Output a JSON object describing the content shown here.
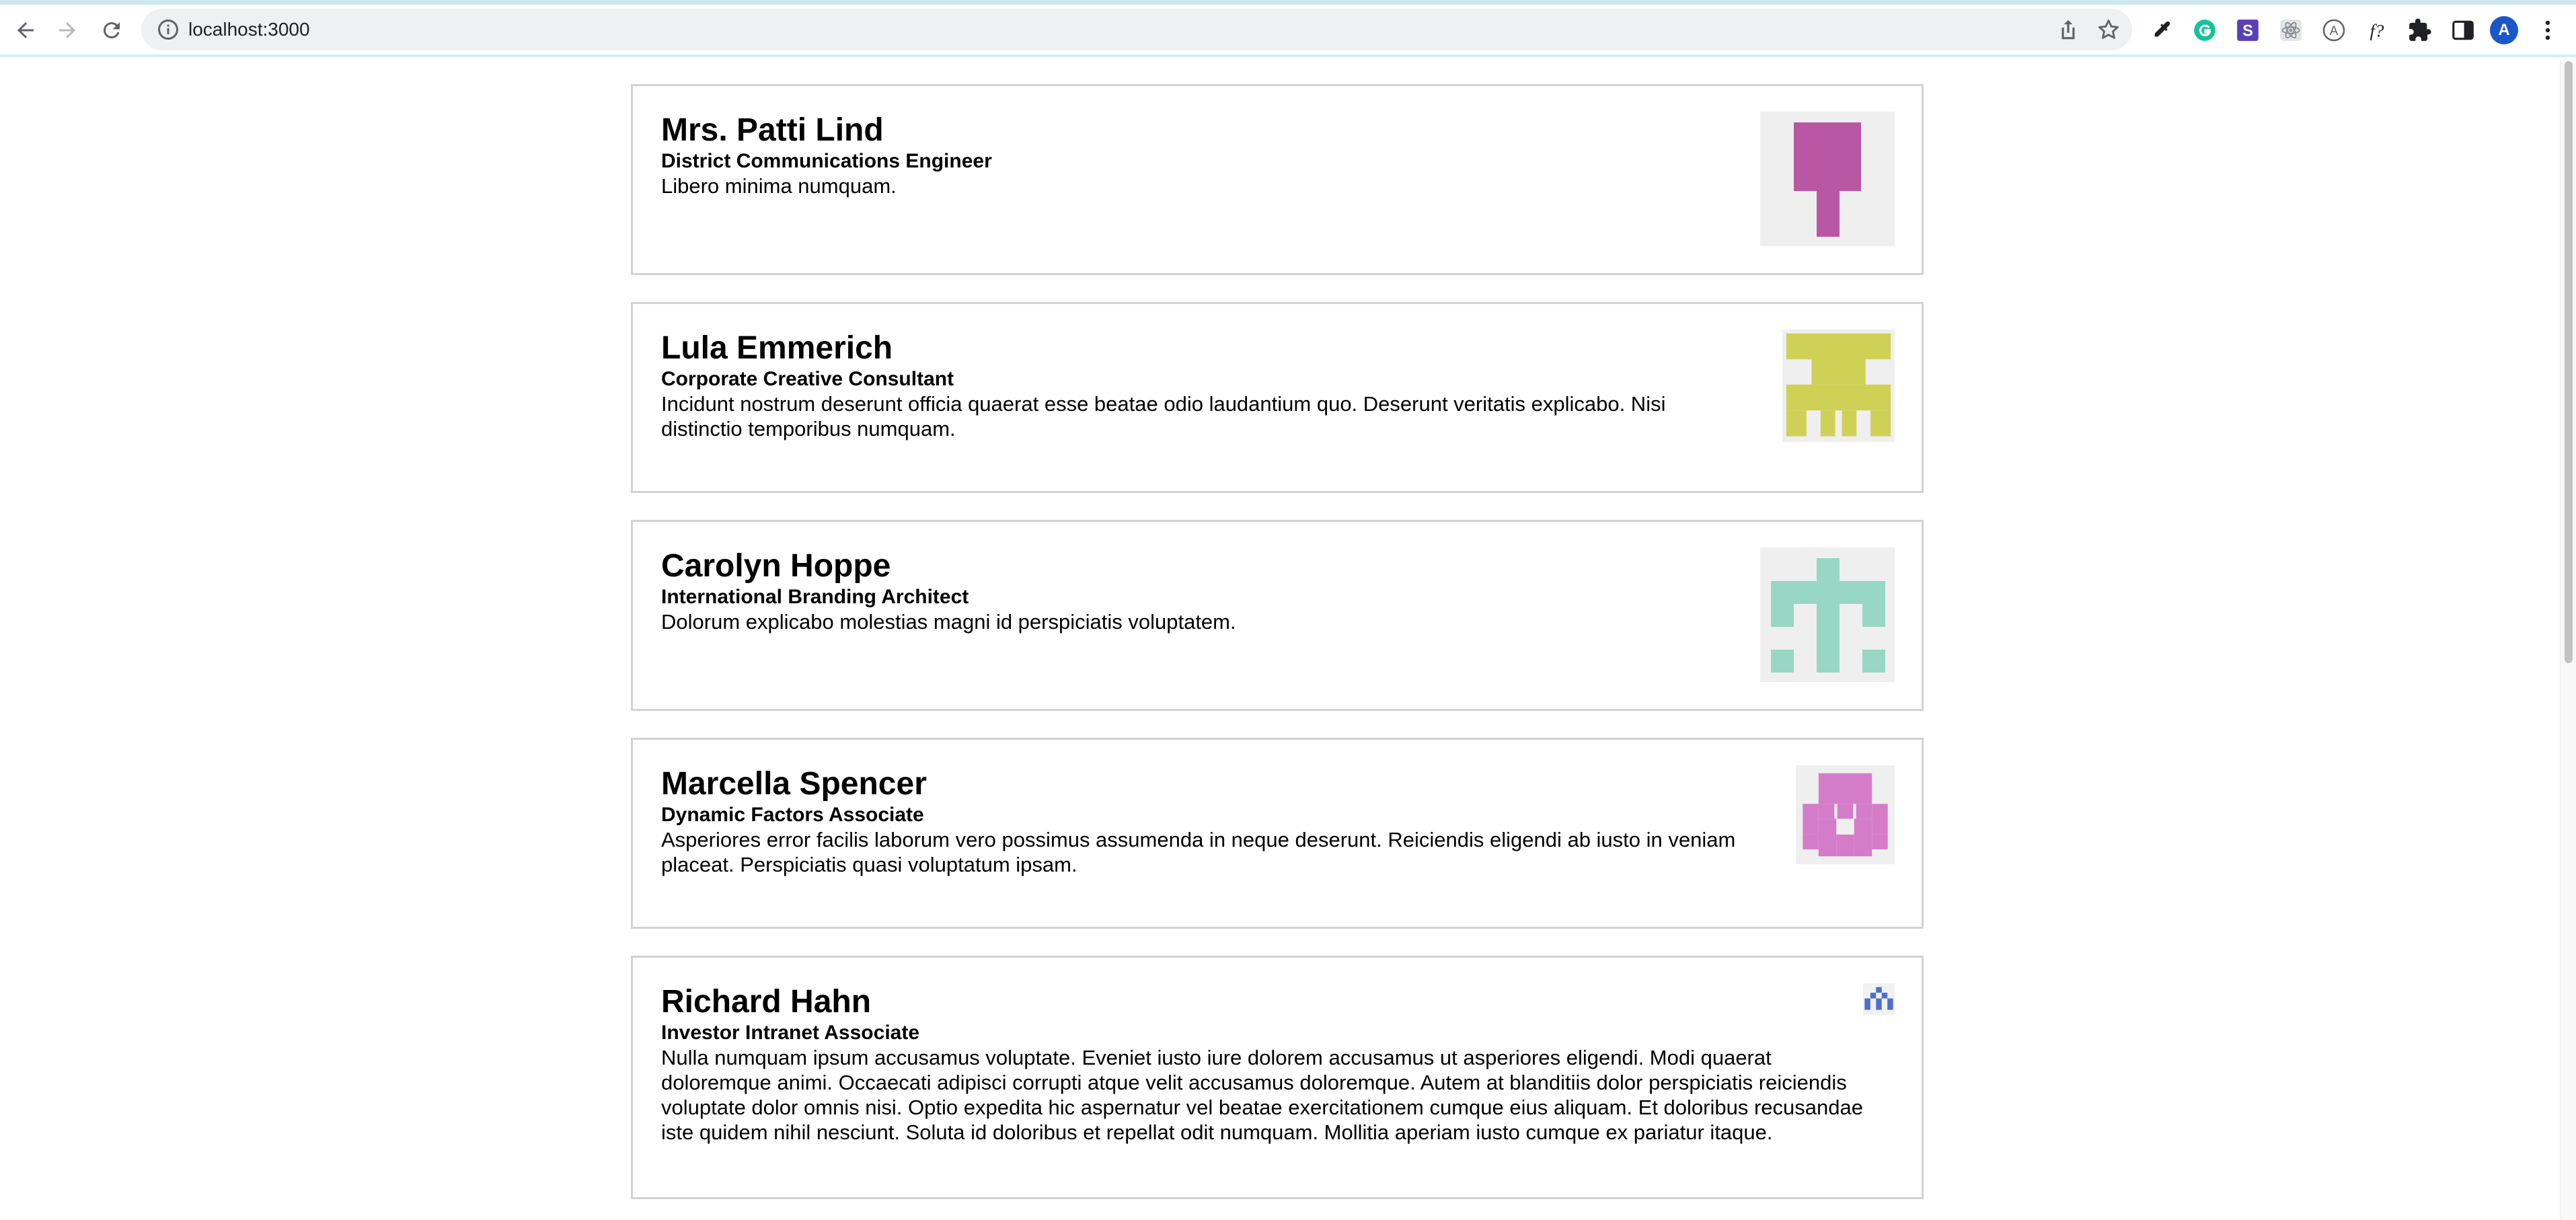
{
  "browser": {
    "url": "localhost:3000",
    "profile_initial": "A",
    "icons": {
      "back": "back-arrow-icon",
      "forward": "forward-arrow-icon",
      "reload": "reload-icon",
      "site_info": "info-icon",
      "share": "share-icon",
      "bookmark": "star-icon",
      "extensions": [
        "eyedropper-icon",
        "grammarly-icon",
        "s-extension-icon",
        "react-devtools-icon",
        "a-extension-icon",
        "formula-icon",
        "puzzle-icon",
        "sidepanel-icon"
      ],
      "menu": "kebab-menu-icon"
    }
  },
  "profiles": [
    {
      "name": "Mrs. Patti Lind",
      "title": "District Communications Engineer",
      "bio": "Libero minima numquam.",
      "avatar_color": "#b957a4"
    },
    {
      "name": "Lula Emmerich",
      "title": "Corporate Creative Consultant",
      "bio": "Incidunt nostrum deserunt officia quaerat esse beatae odio laudantium quo. Deserunt veritatis explicabo. Nisi distinctio temporibus numquam.",
      "avatar_color": "#cfd156"
    },
    {
      "name": "Carolyn Hoppe",
      "title": "International Branding Architect",
      "bio": "Dolorum explicabo molestias magni id perspiciatis voluptatem.",
      "avatar_color": "#97d7c4"
    },
    {
      "name": "Marcella Spencer",
      "title": "Dynamic Factors Associate",
      "bio": "Asperiores error facilis laborum vero possimus assumenda in neque deserunt. Reiciendis eligendi ab iusto in veniam placeat. Perspiciatis quasi voluptatum ipsam.",
      "avatar_color": "#d57cc9"
    },
    {
      "name": "Richard Hahn",
      "title": "Investor Intranet Associate",
      "bio": "Nulla numquam ipsum accusamus voluptate. Eveniet iusto iure dolorem accusamus ut asperiores eligendi. Modi quaerat doloremque animi. Occaecati adipisci corrupti atque velit accusamus doloremque. Autem at blanditiis dolor perspiciatis reiciendis voluptate dolor omnis nisi. Optio expedita hic aspernatur vel beatae exercitationem cumque eius aliquam. Et doloribus recusandae iste quidem nihil nesciunt. Soluta id doloribus et repellat odit numquam. Mollitia aperiam iusto cumque ex pariatur itaque.",
      "avatar_color": "#4a6fd0"
    }
  ]
}
